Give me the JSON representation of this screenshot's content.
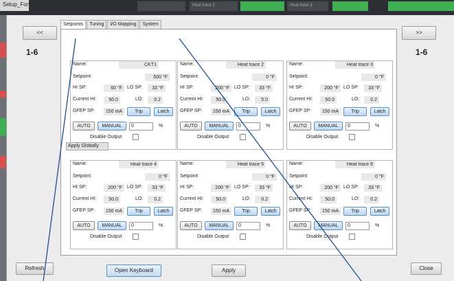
{
  "window": {
    "title": "Setup_Form"
  },
  "top_tiles": [
    "Heat trace 2",
    "Heat trace 3"
  ],
  "nav": {
    "prev_label": "<<",
    "next_label": ">>",
    "left_range": "1-6",
    "right_range": "1-6"
  },
  "tabs": [
    {
      "label": "Setpoints",
      "active": true
    },
    {
      "label": "Tuning",
      "active": false
    },
    {
      "label": "I/O Mapping",
      "active": false
    },
    {
      "label": "System",
      "active": false
    }
  ],
  "labels": {
    "name": "Name:",
    "setpoint": "Setpoint:",
    "hi_sp": "HI SP:",
    "lo_sp": "LO SP:",
    "current_hi": "Current HI:",
    "lo": "LO:",
    "gfep_sp": "GFEP SP:",
    "trip": "Trip",
    "latch": "Latch",
    "auto": "AUTO",
    "manual": "MANUAL",
    "percent": "%",
    "disable_output": "Disable Output"
  },
  "circuits": [
    {
      "name": "CKT1",
      "setpoint": "500 °F",
      "hi_sp": "60 °F",
      "lo_sp": "33 °F",
      "current_hi": "50.0",
      "current_lo": "0.2",
      "gfep_sp": "150 mA",
      "manual_value": "0"
    },
    {
      "name": "Heat trace 2",
      "setpoint": "0 °F",
      "hi_sp": "200 °F",
      "lo_sp": "33 °F",
      "current_hi": "50.0",
      "current_lo": "5.0",
      "gfep_sp": "150 mA",
      "manual_value": "0"
    },
    {
      "name": "Heat trace 3",
      "setpoint": "0 °F",
      "hi_sp": "200 °F",
      "lo_sp": "33 °F",
      "current_hi": "50.0",
      "current_lo": "0.2",
      "gfep_sp": "150 mA",
      "manual_value": "0"
    },
    {
      "name": "Heat trace 4",
      "setpoint": "0 °F",
      "hi_sp": "200 °F",
      "lo_sp": "33 °F",
      "current_hi": "50.0",
      "current_lo": "0.2",
      "gfep_sp": "150 mA",
      "manual_value": "0"
    },
    {
      "name": "Heat trace 5",
      "setpoint": "0 °F",
      "hi_sp": "200 °F",
      "lo_sp": "33 °F",
      "current_hi": "50.0",
      "current_lo": "0.2",
      "gfep_sp": "150 mA",
      "manual_value": "0"
    },
    {
      "name": "Heat trace 6",
      "setpoint": "0 °F",
      "hi_sp": "200 °F",
      "lo_sp": "33 °F",
      "current_hi": "50.0",
      "current_lo": "0.2",
      "gfep_sp": "150 mA",
      "manual_value": "0"
    }
  ],
  "apply_globally_label": "Apply Globally",
  "footer": {
    "refresh_label": "Refresh",
    "open_keyboard_label": "Open Keyboard",
    "apply_label": "Apply",
    "close_label": "Close"
  }
}
